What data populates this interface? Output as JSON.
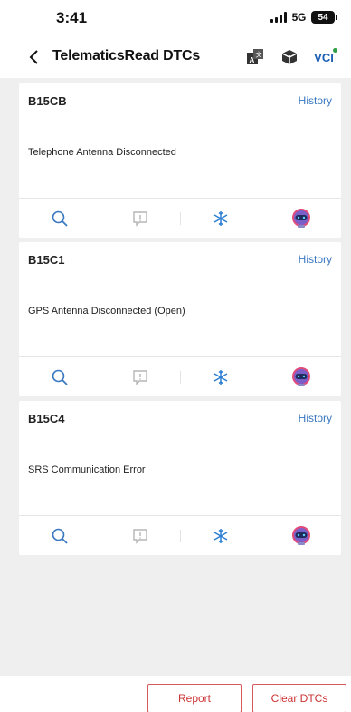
{
  "status": {
    "time": "3:41",
    "network": "5G",
    "battery": "54"
  },
  "nav": {
    "title": "TelematicsRead DTCs",
    "vci_label": "VCI"
  },
  "dtcs": [
    {
      "code": "B15CB",
      "history_label": "History",
      "description": "Telephone Antenna Disconnected"
    },
    {
      "code": "B15C1",
      "history_label": "History",
      "description": "GPS Antenna Disconnected (Open)"
    },
    {
      "code": "B15C4",
      "history_label": "History",
      "description": "SRS Communication Error"
    }
  ],
  "footer": {
    "report_label": "Report",
    "clear_label": "Clear DTCs"
  },
  "colors": {
    "accent_blue": "#3a78c2",
    "button_red": "#c33333"
  }
}
